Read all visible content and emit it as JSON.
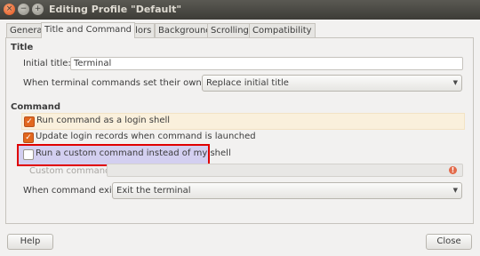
{
  "window": {
    "title": "Editing Profile \"Default\"",
    "controls": {
      "close": "×",
      "minimize": "−",
      "maximize": "+"
    }
  },
  "tabs": [
    "General",
    "Title and Command",
    "Colors",
    "Background",
    "Scrolling",
    "Compatibility"
  ],
  "title_section": {
    "heading": "Title",
    "initial_title_label": "Initial title:",
    "initial_title_value": "Terminal",
    "own_titles_label": "When terminal commands set their own titles:",
    "own_titles_value": "Replace initial title"
  },
  "command_section": {
    "heading": "Command",
    "login_shell_label": "Run command as a login shell",
    "login_shell_checked": true,
    "update_records_label": "Update login records when command is launched",
    "update_records_checked": true,
    "custom_command_toggle_label": "Run a custom command instead of my shell",
    "custom_command_toggle_checked": false,
    "custom_command_label": "Custom command:",
    "custom_command_value": "",
    "command_exits_label": "When command exits:",
    "command_exits_value": "Exit the terminal"
  },
  "buttons": {
    "help": "Help",
    "close": "Close"
  },
  "colors": {
    "accent": "#e2671e",
    "highlight_box": "#e00000",
    "titlebar": "#3d3c37"
  }
}
